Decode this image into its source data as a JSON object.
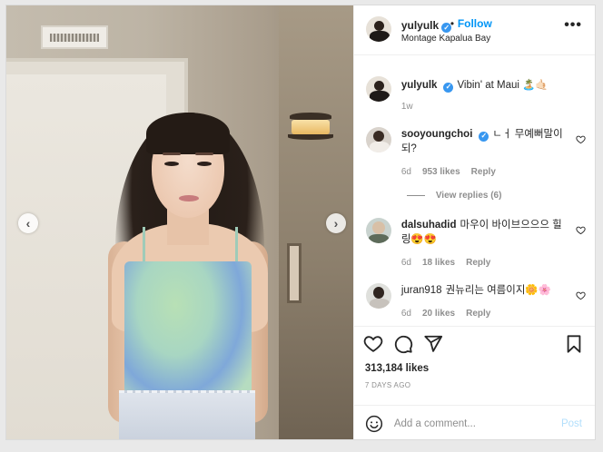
{
  "header": {
    "username": "yulyulk",
    "follow_label": "Follow",
    "separator": "•",
    "location": "Montage Kapalua Bay",
    "more_icon": "more-horizontal-icon"
  },
  "caption": {
    "username": "yulyulk",
    "text": "Vibin' at Maui 🏝️🤙🏻",
    "time": "1w"
  },
  "comments": [
    {
      "username": "sooyoungchoi",
      "verified": true,
      "text": "ㄴㅓ 무예뻐말이 되?",
      "time": "6d",
      "likes": "953 likes",
      "reply": "Reply",
      "view_replies": "View replies (6)"
    },
    {
      "username": "dalsuhadid",
      "verified": false,
      "text": "마우이 바이브으으으 힐링😍😍",
      "time": "6d",
      "likes": "18 likes",
      "reply": "Reply"
    },
    {
      "username": "juran918",
      "verified": false,
      "text": "권뉴리는 여름이지🌼🌸",
      "time": "6d",
      "likes": "20 likes",
      "reply": "Reply"
    }
  ],
  "stats": {
    "likes": "313,184 likes",
    "posted": "7 DAYS AGO"
  },
  "add_comment": {
    "placeholder": "Add a comment...",
    "post_label": "Post"
  },
  "media_nav": {
    "prev": "‹",
    "next": "›"
  },
  "colors": {
    "accent": "#0095f6",
    "verified": "#3897f0",
    "muted": "#8e8e8e",
    "post_disabled": "#b2dffc"
  }
}
